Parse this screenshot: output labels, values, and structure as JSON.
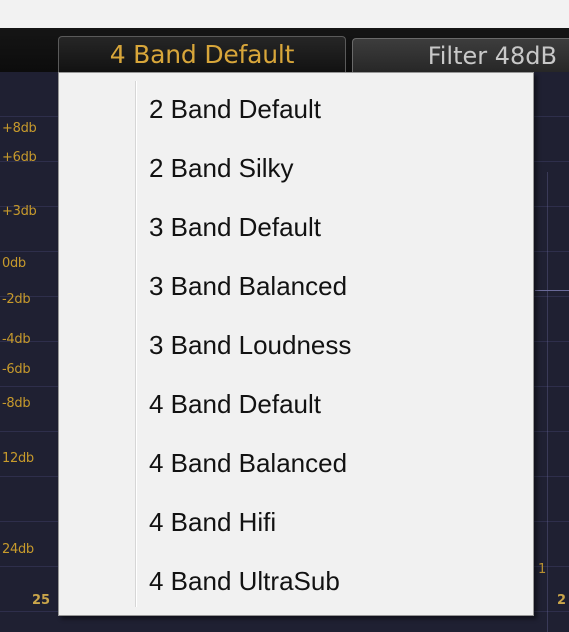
{
  "toolbar": {
    "preset_label": "4 Band Default",
    "filter_label": "Filter 48dB"
  },
  "graph": {
    "db_labels": [
      "+8db",
      "+6db",
      "+3db",
      "0db",
      "-2db",
      "-4db",
      "-6db",
      "-8db",
      "12db",
      "24db"
    ],
    "freq_left": "25",
    "freq_right": "2",
    "marker": "1"
  },
  "menu": {
    "items": [
      "2 Band Default",
      "2 Band Silky",
      "3 Band Default",
      "3 Band Balanced",
      "3 Band Loudness",
      "4 Band Default",
      "4 Band Balanced",
      "4 Band Hifi",
      "4 Band UltraSub"
    ]
  },
  "colors": {
    "accent_gold": "#d8a63a",
    "menu_bg": "#f1f1f1",
    "graph_bg": "#1f2032"
  }
}
